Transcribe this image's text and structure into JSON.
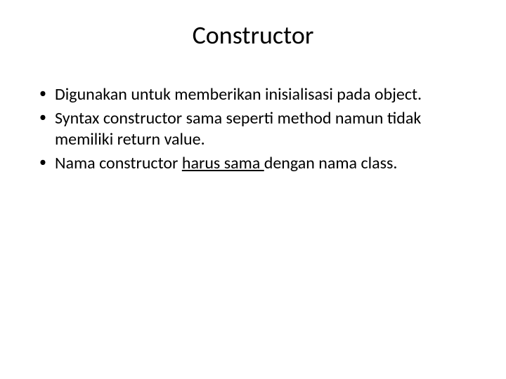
{
  "slide": {
    "title": "Constructor",
    "bullets": [
      {
        "pre": "Digunakan untuk memberikan inisialisasi pada object.",
        "underline": "",
        "post": ""
      },
      {
        "pre": "Syntax constructor sama seperti method namun tidak memiliki return value.",
        "underline": "",
        "post": ""
      },
      {
        "pre": "Nama constructor ",
        "underline": "harus sama ",
        "post": "dengan nama class."
      }
    ]
  }
}
